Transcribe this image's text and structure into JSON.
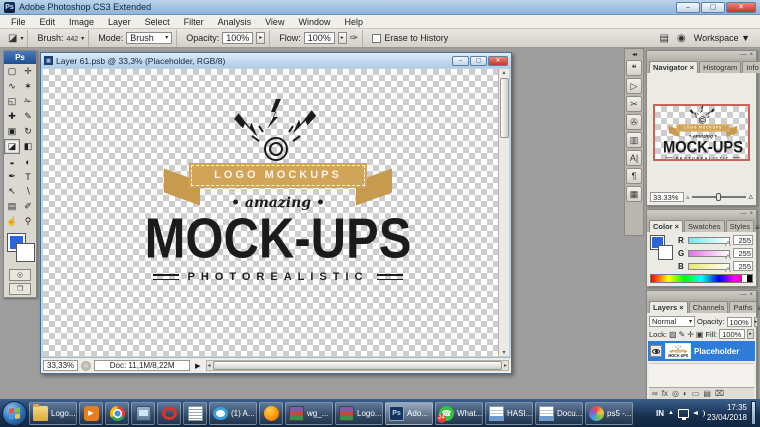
{
  "window": {
    "title": "Adobe Photoshop CS3 Extended",
    "app_icon": "Ps",
    "controls": {
      "minimize": "–",
      "maximize": "▢",
      "close": "✕"
    }
  },
  "menubar": {
    "items": [
      "File",
      "Edit",
      "Image",
      "Layer",
      "Select",
      "Filter",
      "Analysis",
      "View",
      "Window",
      "Help"
    ]
  },
  "options": {
    "tool_glyph": "◪",
    "brush_label": "Brush:",
    "brush_size": "442",
    "mode_label": "Mode:",
    "mode_value": "Brush",
    "opacity_label": "Opacity:",
    "opacity_value": "100%",
    "flow_label": "Flow:",
    "flow_value": "100%",
    "airbrush_glyph": "✑",
    "erase_history_label": "Erase to History",
    "erase_history_checked": false,
    "bridge_glyph": "▤",
    "palette_well_glyph": "◉",
    "workspace_label": "Workspace ▼"
  },
  "toolbox": {
    "header": "Ps",
    "foreground_color": "#2b65d9",
    "background_color": "#ffffff",
    "mask_button_glyph": "◎",
    "screen_button_glyph": "❐",
    "tools": [
      {
        "name": "rectangular-marquee-tool",
        "glyph": "▢",
        "selected": false
      },
      {
        "name": "move-tool",
        "glyph": "✛",
        "selected": false
      },
      {
        "name": "lasso-tool",
        "glyph": "∿",
        "selected": false
      },
      {
        "name": "magic-wand-tool",
        "glyph": "✶",
        "selected": false
      },
      {
        "name": "crop-tool",
        "glyph": "◱",
        "selected": false
      },
      {
        "name": "slice-tool",
        "glyph": "✁",
        "selected": false
      },
      {
        "name": "healing-brush-tool",
        "glyph": "✚",
        "selected": false
      },
      {
        "name": "brush-tool",
        "glyph": "✎",
        "selected": false
      },
      {
        "name": "clone-stamp-tool",
        "glyph": "▣",
        "selected": false
      },
      {
        "name": "history-brush-tool",
        "glyph": "↻",
        "selected": false
      },
      {
        "name": "eraser-tool",
        "glyph": "◪",
        "selected": true
      },
      {
        "name": "gradient-tool",
        "glyph": "◧",
        "selected": false
      },
      {
        "name": "blur-tool",
        "glyph": "◒",
        "selected": false
      },
      {
        "name": "dodge-tool",
        "glyph": "◐",
        "selected": false
      },
      {
        "name": "pen-tool",
        "glyph": "✒",
        "selected": false
      },
      {
        "name": "type-tool",
        "glyph": "T",
        "selected": false
      },
      {
        "name": "path-selection-tool",
        "glyph": "↖",
        "selected": false
      },
      {
        "name": "shape-tool",
        "glyph": "∖",
        "selected": false
      },
      {
        "name": "notes-tool",
        "glyph": "▤",
        "selected": false
      },
      {
        "name": "eyedropper-tool",
        "glyph": "✐",
        "selected": false
      },
      {
        "name": "hand-tool",
        "glyph": "☝",
        "selected": false
      },
      {
        "name": "zoom-tool",
        "glyph": "⚲",
        "selected": false
      }
    ]
  },
  "document": {
    "title": "Layer 61.psb @ 33,3% (Placeholder, RGB/8)",
    "status_zoom": "33,33%",
    "status_doc": "Doc: 11,1M/8,22M"
  },
  "logo": {
    "banner": "LOGO MOCKUPS",
    "script_word": "amazing",
    "title": "MOCK-UPS",
    "subtitle": "PHOTOREALISTIC",
    "ribbon_color": "#d2a459",
    "text_color": "#1b1b1b"
  },
  "dock_icons": [
    {
      "name": "brushes-panel-icon",
      "glyph": "❝"
    },
    {
      "name": "actions-panel-icon",
      "glyph": "▷"
    },
    {
      "name": "tool-presets-panel-icon",
      "glyph": "✂"
    },
    {
      "name": "clone-source-panel-icon",
      "glyph": "✇"
    },
    {
      "name": "animation-panel-icon",
      "glyph": "▥"
    },
    {
      "name": "character-panel-icon",
      "glyph": "A|"
    },
    {
      "name": "paragraph-panel-icon",
      "glyph": "¶"
    },
    {
      "name": "layer-comps-panel-icon",
      "glyph": "▦"
    }
  ],
  "panels": {
    "navigator": {
      "tabs": [
        "Navigator ×",
        "Histogram",
        "Info"
      ],
      "zoom_value": "33.33%"
    },
    "color": {
      "tabs": [
        "Color ×",
        "Swatches",
        "Styles"
      ],
      "channels": [
        {
          "label": "R",
          "value": "255",
          "ramp": "cyan"
        },
        {
          "label": "G",
          "value": "255",
          "ramp": "magenta"
        },
        {
          "label": "B",
          "value": "255",
          "ramp": "yellow"
        }
      ]
    },
    "layers": {
      "tabs": [
        "Layers ×",
        "Channels",
        "Paths"
      ],
      "blend_mode": "Normal",
      "opacity_label": "Opacity:",
      "opacity_value": "100%",
      "lock_label": "Lock:",
      "lock_icons": [
        "lock-transparency-icon",
        "lock-paint-icon",
        "lock-position-icon",
        "lock-all-icon"
      ],
      "lock_glyphs": [
        "▨",
        "✎",
        "✛",
        "▣"
      ],
      "fill_label": "Fill:",
      "fill_value": "100%",
      "layer_name": "Placeholder",
      "bottom_icons": [
        {
          "name": "link-layers-icon",
          "glyph": "∞"
        },
        {
          "name": "layer-style-fx-icon",
          "glyph": "fx"
        },
        {
          "name": "layer-mask-icon",
          "glyph": "◎"
        },
        {
          "name": "adjustment-layer-icon",
          "glyph": "◐"
        },
        {
          "name": "layer-group-icon",
          "glyph": "▭"
        },
        {
          "name": "new-layer-icon",
          "glyph": "▤"
        },
        {
          "name": "delete-layer-icon",
          "glyph": "⌧"
        }
      ]
    }
  },
  "icons": {
    "status_menu": "▶",
    "scroll_up": "▴",
    "scroll_down": "▾",
    "scroll_left": "◂",
    "scroll_right": "▸",
    "panel_menu": "≡",
    "dock_collapse": "◂◂",
    "panel_min": "—",
    "panel_close": "×"
  },
  "taskbar": {
    "items": [
      {
        "name": "taskbar-item-folder-logo",
        "type": "folder",
        "label": "Logo..."
      },
      {
        "name": "taskbar-item-media-player",
        "type": "player",
        "glyph": "▶"
      },
      {
        "name": "taskbar-item-chrome",
        "type": "chrome"
      },
      {
        "name": "taskbar-item-display-settings",
        "type": "display"
      },
      {
        "name": "taskbar-item-opera",
        "type": "opera"
      },
      {
        "name": "taskbar-item-notes",
        "type": "mail"
      },
      {
        "name": "taskbar-item-browser-notification",
        "type": "bluecircle",
        "label": "(1) A..."
      },
      {
        "name": "taskbar-item-firefox",
        "type": "firefox"
      },
      {
        "name": "taskbar-item-winrar-wg",
        "type": "winrar",
        "label": "wg_..."
      },
      {
        "name": "taskbar-item-winrar-logo",
        "type": "winrar",
        "label": "Logo..."
      },
      {
        "name": "taskbar-item-photoshop",
        "type": "photoshop",
        "glyph": "Ps",
        "label": "Ado...",
        "active": true
      },
      {
        "name": "taskbar-item-whatsapp",
        "type": "whatsapp",
        "glyph": "☎",
        "label": "What...",
        "badge": "24"
      },
      {
        "name": "taskbar-item-word-hasi",
        "type": "word",
        "label": "HASI..."
      },
      {
        "name": "taskbar-item-word-docu",
        "type": "word",
        "label": "Docu..."
      },
      {
        "name": "taskbar-item-image-ps5",
        "type": "paint",
        "label": "ps5 -..."
      }
    ],
    "tray": {
      "language": "IN",
      "expand_arrow": "▲",
      "time": "17:35",
      "date": "23/04/2018"
    }
  }
}
